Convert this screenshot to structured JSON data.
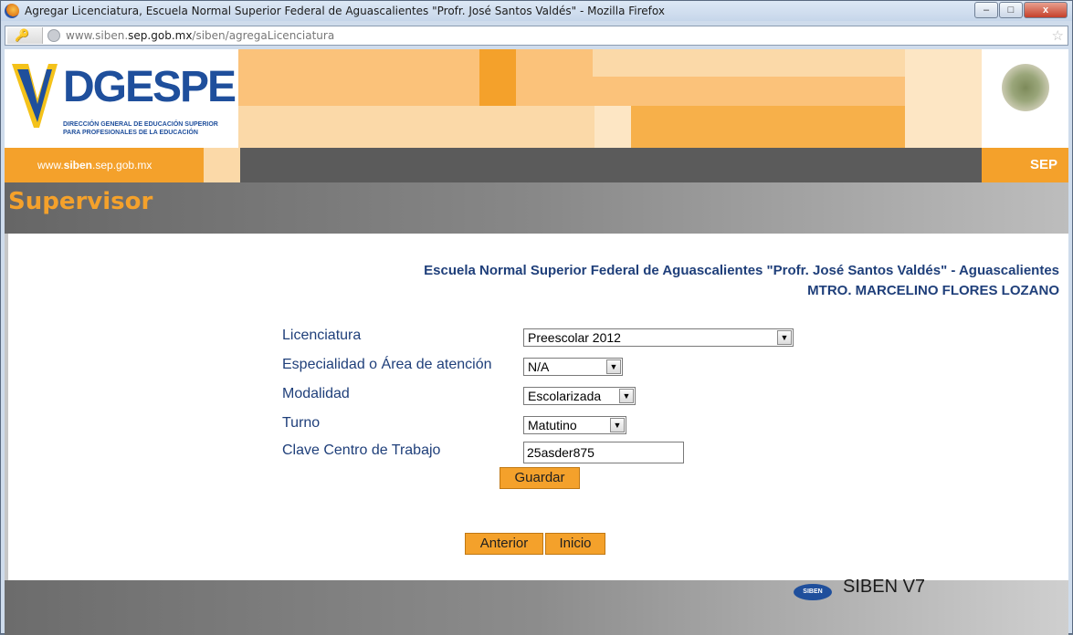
{
  "window": {
    "title": "Agregar Licenciatura, Escuela Normal Superior Federal de Aguascalientes \"Profr. José Santos Valdés\" - Mozilla Firefox",
    "minimize": "–",
    "maximize": "□",
    "close": "x"
  },
  "address": {
    "prefix": "www.siben.",
    "domain": "sep.gob.mx",
    "path": "/siben/agregaLicenciatura"
  },
  "header": {
    "logo_text": "DGESPE",
    "logo_subtitle_1": "DIRECCIÓN GENERAL DE EDUCACIÓN SUPERIOR",
    "logo_subtitle_2": "PARA PROFESIONALES DE LA EDUCACIÓN",
    "site_url_prefix": "www.",
    "site_url_bold": "siben",
    "site_url_suffix": ".sep.gob.mx",
    "sep_label": "SEP",
    "section_title": "Supervisor",
    "colors": {
      "orange": "#f4a12b",
      "light_orange": "#fbd9a8",
      "pale_orange": "#fde6c4",
      "blue": "#1f3f7a"
    }
  },
  "school": {
    "name": "Escuela Normal Superior Federal de Aguascalientes \"Profr. José Santos Valdés\" - Aguascalientes",
    "director": "MTRO. MARCELINO FLORES LOZANO"
  },
  "form": {
    "licenciatura_label": "Licenciatura",
    "licenciatura_value": "Preescolar 2012",
    "especialidad_label": "Especialidad o Área de atención",
    "especialidad_value": "N/A",
    "modalidad_label": "Modalidad",
    "modalidad_value": "Escolarizada",
    "turno_label": "Turno",
    "turno_value": "Matutino",
    "clave_label": "Clave Centro de Trabajo",
    "clave_value": "25asder875",
    "save_label": "Guardar"
  },
  "nav": {
    "previous_label": "Anterior",
    "home_label": "Inicio"
  },
  "footer": {
    "logo_text": "SIBEN",
    "version_text": "SIBEN  V7"
  }
}
